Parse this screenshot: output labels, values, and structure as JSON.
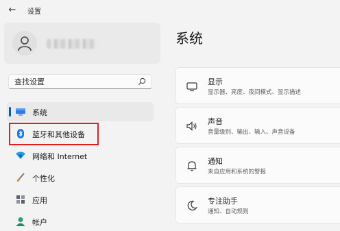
{
  "titlebar": {
    "back_icon": "←",
    "app_title": "设置"
  },
  "search": {
    "placeholder": "查找设置"
  },
  "sidebar": {
    "items": [
      {
        "label": "系统",
        "icon": "monitor-icon"
      },
      {
        "label": "蓝牙和其他设备",
        "icon": "bluetooth-icon"
      },
      {
        "label": "网络和 Internet",
        "icon": "wifi-icon"
      },
      {
        "label": "个性化",
        "icon": "brush-icon"
      },
      {
        "label": "应用",
        "icon": "apps-icon"
      },
      {
        "label": "帐户",
        "icon": "account-icon"
      }
    ]
  },
  "main": {
    "title": "系统",
    "cards": [
      {
        "title": "显示",
        "desc": "显示器、亮度、夜间模式、显示描述",
        "icon": "display-icon"
      },
      {
        "title": "声音",
        "desc": "音量级别、输出、输入、声音设备",
        "icon": "speaker-icon"
      },
      {
        "title": "通知",
        "desc": "来自应用和系统的警报",
        "icon": "bell-icon"
      },
      {
        "title": "专注助手",
        "desc": "通知、自动规则",
        "icon": "moon-icon"
      }
    ]
  },
  "colors": {
    "accent": "#005fb8",
    "highlight": "#e02020",
    "bluetooth": "#1f7ae0"
  }
}
